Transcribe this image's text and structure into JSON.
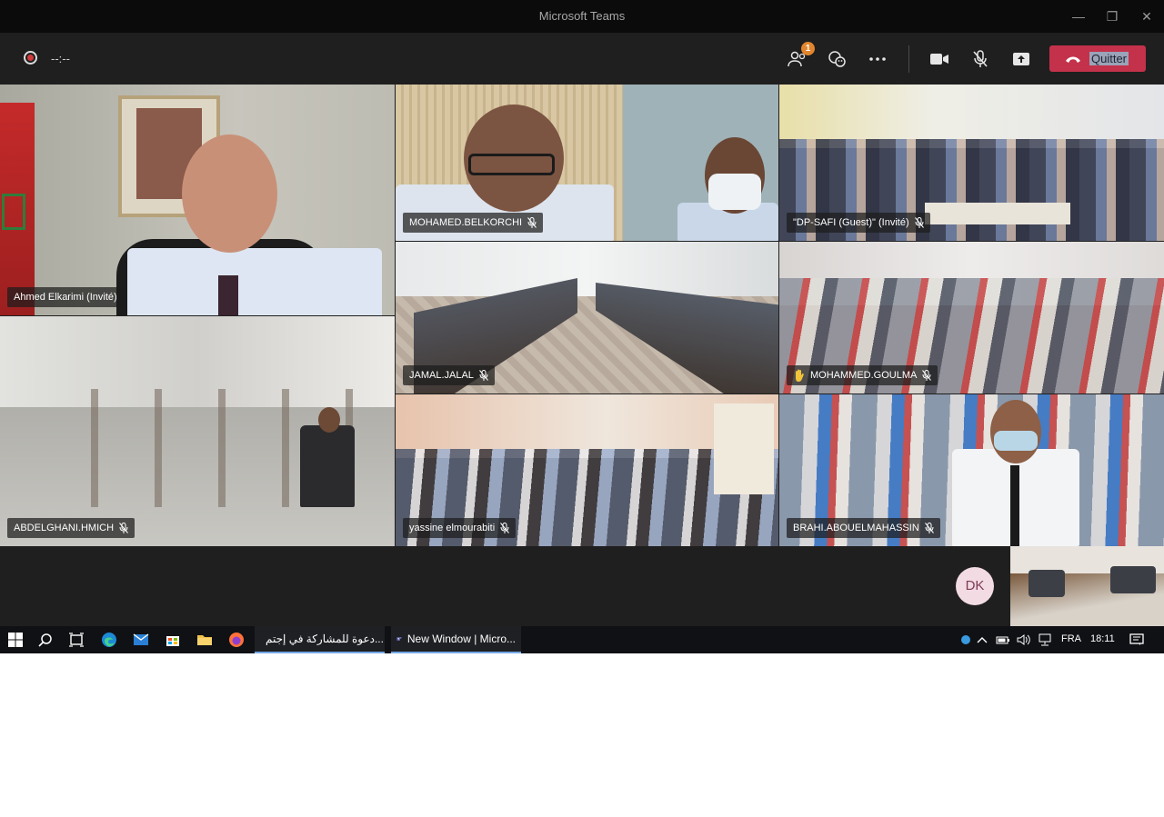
{
  "window": {
    "title": "Microsoft Teams",
    "minimize_glyph": "—",
    "restore_glyph": "❐",
    "close_glyph": "✕"
  },
  "controls": {
    "timer": "--:--",
    "participants_badge": "1",
    "leave_label": "Quitter",
    "icons": [
      "record-icon",
      "participants-icon",
      "chat-reactions-icon",
      "more-options-icon",
      "camera-icon",
      "mic-muted-icon",
      "share-screen-icon",
      "hang-up-icon"
    ],
    "leave_color": "#c4314b"
  },
  "participants": [
    {
      "name": "Ahmed Elkarimi (Invité)"
    },
    {
      "name": "MOHAMED.BELKORCHI"
    },
    {
      "name": "\"DP-SAFI (Guest)\" (Invité)"
    },
    {
      "name": "JAMAL.JALAL"
    },
    {
      "name": "MOHAMMED.GOULMA",
      "hand_raised": true
    },
    {
      "name": "ABDELGHANI.HMICH"
    },
    {
      "name": "yassine elmourabiti"
    },
    {
      "name": "BRAHI.ABOUELMAHASSIN"
    }
  ],
  "self": {
    "initials": "DK"
  },
  "taskbar": {
    "apps": [
      {
        "label": "دعوة للمشاركة في إجتم..."
      },
      {
        "label": "New Window | Micro..."
      }
    ],
    "language": "FRA",
    "time": "18:11"
  }
}
